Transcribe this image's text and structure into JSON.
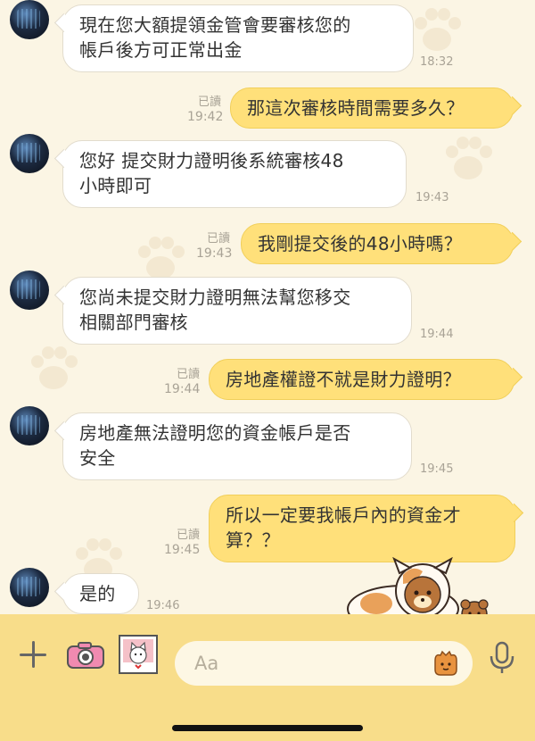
{
  "messages": [
    {
      "side": "in",
      "text": "現在您大額提領金管會要審核您的\n帳戶後方可正常出金",
      "time": "18:32"
    },
    {
      "side": "out",
      "text": "那這次審核時間需要多久？",
      "read": "已讀",
      "time": "19:42"
    },
    {
      "side": "in",
      "text": "您好 提交財力證明後系統審核48\n小時即可",
      "time": "19:43"
    },
    {
      "side": "out",
      "text": "我剛提交後的48小時嗎？",
      "read": "已讀",
      "time": "19:43"
    },
    {
      "side": "in",
      "text": "您尚未提交財力證明無法幫您移交\n相關部門審核",
      "time": "19:44"
    },
    {
      "side": "out",
      "text": "房地產權證不就是財力證明？",
      "read": "已讀",
      "time": "19:44"
    },
    {
      "side": "in",
      "text": "房地產無法證明您的資金帳戶是否\n安全",
      "time": "19:45"
    },
    {
      "side": "out",
      "text": "所以一定要我帳戶內的資金才\n算？？",
      "read": "已讀",
      "time": "19:45"
    },
    {
      "side": "in",
      "text": "是的",
      "time": "19:46"
    }
  ],
  "input": {
    "placeholder": "Aa"
  },
  "icons": {
    "plus": "plus-icon",
    "camera": "camera-icon",
    "photo": "photo-icon",
    "sticker": "sticker-icon",
    "mic": "microphone-icon"
  },
  "colors": {
    "outgoing": "#ffe07a",
    "incoming": "#ffffff",
    "toolbar": "#f8dd8a",
    "background": "#fbf5e4"
  }
}
